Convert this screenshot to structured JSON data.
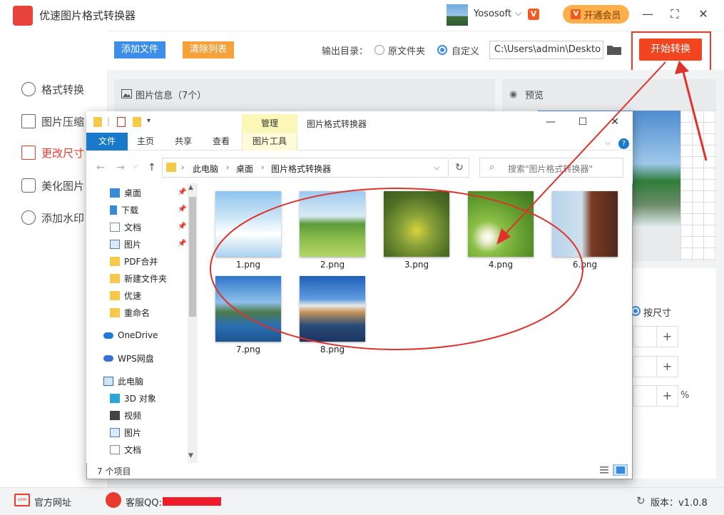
{
  "app": {
    "title": "优速图片格式转换器",
    "username": "Yososoft",
    "vip_label": "开通会员",
    "window_buttons": [
      "minimize-icon",
      "maximize-icon",
      "close-icon"
    ]
  },
  "toolbar": {
    "add_file": "添加文件",
    "clear_list": "清除列表",
    "output_label": "输出目录：",
    "radio_original": "原文件夹",
    "radio_custom": "自定义",
    "path_value": "C:\\Users\\admin\\Deskto",
    "start_button": "开始转换"
  },
  "sidebar": {
    "items": [
      {
        "label": "格式转换",
        "icon": "format-convert-icon"
      },
      {
        "label": "图片压缩",
        "icon": "compress-icon"
      },
      {
        "label": "更改尺寸",
        "icon": "resize-icon",
        "active": true
      },
      {
        "label": "美化图片",
        "icon": "beautify-icon"
      },
      {
        "label": "添加水印",
        "icon": "watermark-icon"
      }
    ]
  },
  "main": {
    "info_title": "图片信息（7个）",
    "preview_title": "预览",
    "by_size_label": "按尺寸",
    "percent_unit": "%",
    "plus": "+"
  },
  "explorer": {
    "title": "图片格式转换器",
    "context_tab": "管理",
    "tabs": [
      "文件",
      "主页",
      "共享",
      "查看",
      "图片工具"
    ],
    "breadcrumb": [
      "此电脑",
      "桌面",
      "图片格式转换器"
    ],
    "search_placeholder": "搜索\"图片格式转换器\"",
    "nav_items": [
      {
        "label": "桌面",
        "icon": "desktop-icon",
        "pinned": true
      },
      {
        "label": "下载",
        "icon": "download-icon",
        "pinned": true
      },
      {
        "label": "文档",
        "icon": "document-icon",
        "pinned": true
      },
      {
        "label": "图片",
        "icon": "pictures-icon",
        "pinned": true
      },
      {
        "label": "PDF合并",
        "icon": "folder-icon"
      },
      {
        "label": "新建文件夹",
        "icon": "folder-icon"
      },
      {
        "label": "优速",
        "icon": "folder-icon"
      },
      {
        "label": "重命名",
        "icon": "folder-icon"
      },
      {
        "label": "OneDrive",
        "icon": "onedrive-icon"
      },
      {
        "label": "WPS网盘",
        "icon": "wps-cloud-icon"
      },
      {
        "label": "此电脑",
        "icon": "this-pc-icon"
      },
      {
        "label": "3D 对象",
        "icon": "3d-objects-icon"
      },
      {
        "label": "视频",
        "icon": "video-icon"
      },
      {
        "label": "图片",
        "icon": "pictures-icon"
      },
      {
        "label": "文档",
        "icon": "document-icon"
      }
    ],
    "files": [
      "1.png",
      "2.png",
      "3.png",
      "4.png",
      "6.png",
      "7.png",
      "8.png"
    ],
    "status": "7 个项目"
  },
  "footer": {
    "site_link": "官方网址",
    "site_icon_text": "com",
    "support_label": "客服QQ:",
    "version": "版本：v1.0.8"
  },
  "colors": {
    "accent_red": "#e83b2e",
    "start_button": "#f0451e",
    "add_blue": "#3d8ee8",
    "clear_orange": "#f7a13b",
    "vip_orange": "#ffb04a",
    "windows_blue": "#1979ca"
  }
}
